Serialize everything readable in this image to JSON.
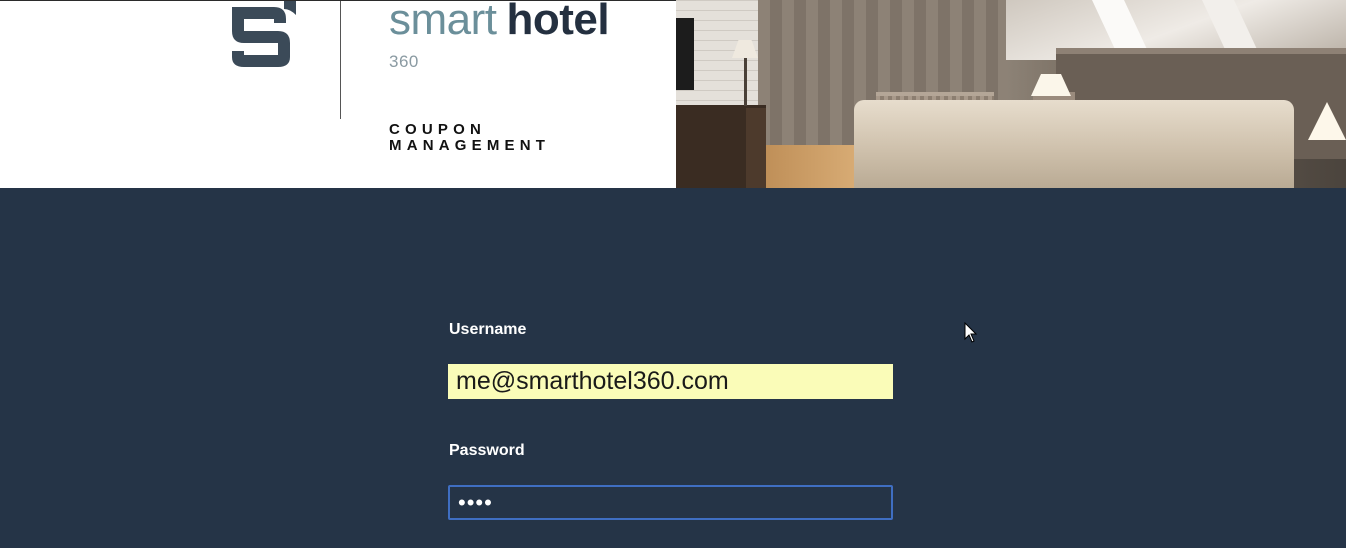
{
  "brand": {
    "title_light": "smart",
    "title_bold": "hotel",
    "subtitle": "360",
    "app_line1": "COUPON",
    "app_line2": "MANAGEMENT",
    "logo_icon": "smarthotel-logo-icon"
  },
  "login": {
    "username_label": "Username",
    "username_value": "me@smarthotel360.com",
    "password_label": "Password",
    "password_value": "••••"
  },
  "colors": {
    "background": "#253447",
    "input_autofill": "#fafcb8",
    "focus_border": "#3f6ec2"
  }
}
